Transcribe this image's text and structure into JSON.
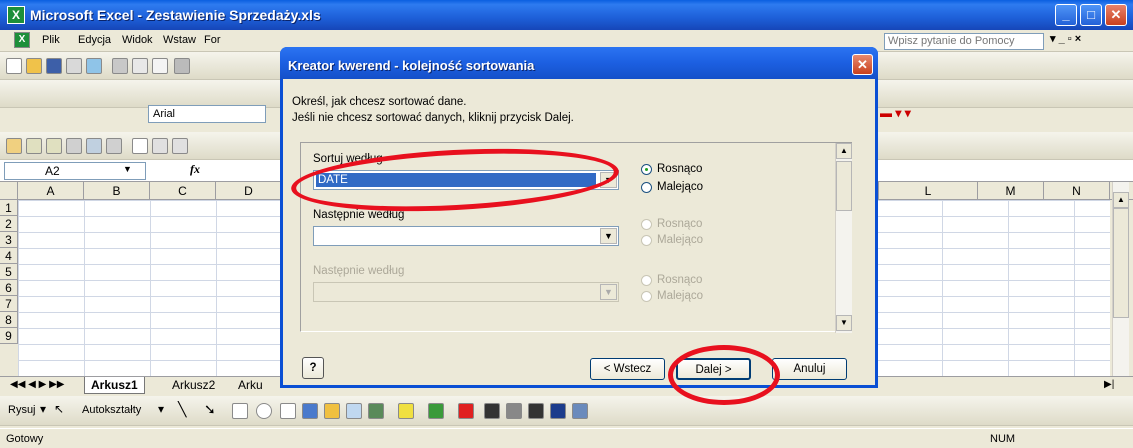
{
  "window": {
    "title": "Microsoft Excel - Zestawienie Sprzedaży.xls"
  },
  "menu": [
    "Plik",
    "Edycja",
    "Widok",
    "Wstaw",
    "For"
  ],
  "help_placeholder": "Wpisz pytanie do Pomocy",
  "font": {
    "name": "Arial"
  },
  "namebox": {
    "value": "A2"
  },
  "fx_label": "fx",
  "columns": [
    "A",
    "B",
    "C",
    "D",
    "L",
    "M",
    "N"
  ],
  "rows": [
    "1",
    "2",
    "3",
    "4",
    "5",
    "6",
    "7",
    "8",
    "9"
  ],
  "sheets": [
    "Arkusz1",
    "Arkusz2",
    "Arku"
  ],
  "draw_toolbar": {
    "draw_label": "Rysuj",
    "autoshapes_label": "Autokształty"
  },
  "status": {
    "ready": "Gotowy",
    "num": "NUM"
  },
  "dialog": {
    "title": "Kreator kwerend - kolejność sortowania",
    "instruction_1": "Określ, jak chcesz sortować dane.",
    "instruction_2": "Jeśli nie chcesz sortować danych, kliknij przycisk Dalej.",
    "sort1": {
      "label": "Sortuj według",
      "value": "DATE",
      "asc": "Rosnąco",
      "desc": "Malejąco"
    },
    "sort2": {
      "label": "Następnie według",
      "value": "",
      "asc": "Rosnąco",
      "desc": "Malejąco"
    },
    "sort3": {
      "label": "Następnie według",
      "value": "",
      "asc": "Rosnąco",
      "desc": "Malejąco"
    },
    "back_label": "< Wstecz",
    "next_label": "Dalej >",
    "cancel_label": "Anuluj",
    "help_icon": "?"
  },
  "colors": {
    "annotation": "#e8101e",
    "xp_blue": "#0a4fd4"
  }
}
